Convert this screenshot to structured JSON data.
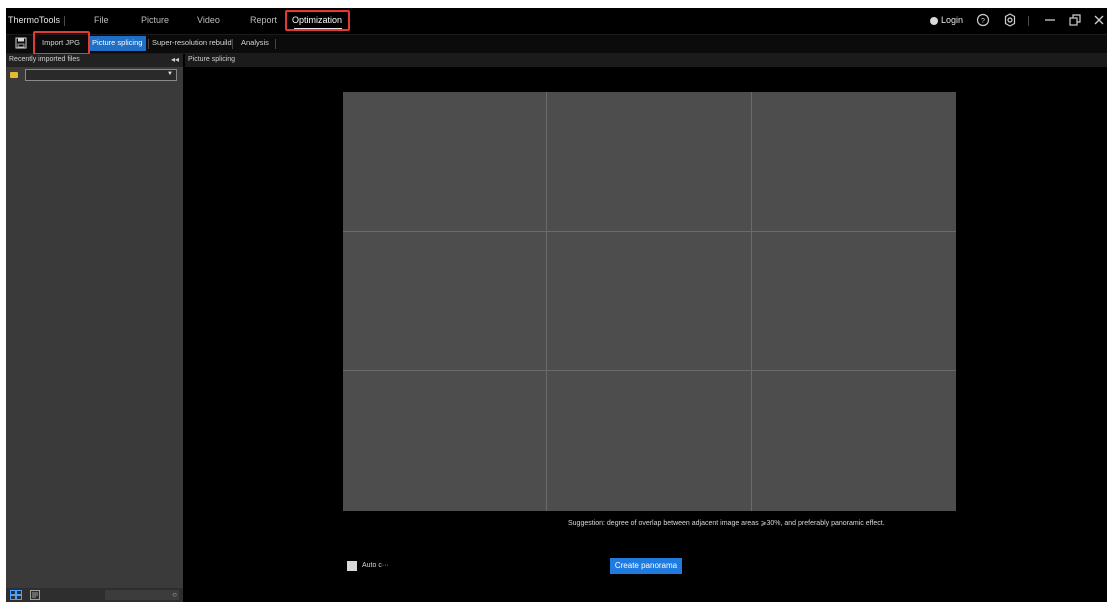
{
  "app": {
    "title": "ThermoTools"
  },
  "menu": {
    "items": [
      {
        "label": "File"
      },
      {
        "label": "Picture"
      },
      {
        "label": "Video"
      },
      {
        "label": "Report"
      },
      {
        "label": "Optimization",
        "active": true
      }
    ],
    "login_label": "Login"
  },
  "toolbar": {
    "save_icon": "save-icon",
    "import_label": "Import JPG",
    "tabs": [
      {
        "label": "Picture splicing",
        "active": true
      },
      {
        "label": "Super-resolution rebuild"
      },
      {
        "label": "Analysis"
      }
    ]
  },
  "sidebar": {
    "title": "Recently imported files",
    "combo_value": "",
    "search_placeholder": ""
  },
  "main": {
    "tab_label": "Picture splicing",
    "grid": {
      "rows": 3,
      "cols": 3
    },
    "suggestion": "Suggestion: degree of overlap between adjacent image areas ⩾30%, and preferably panoramic effect.",
    "auto_label": "Auto c···",
    "create_label": "Create panorama"
  },
  "colors": {
    "accent": "#1f7be0",
    "tab_active": "#1f6fc6",
    "highlight": "#e53935",
    "folder": "#e6b82e"
  }
}
